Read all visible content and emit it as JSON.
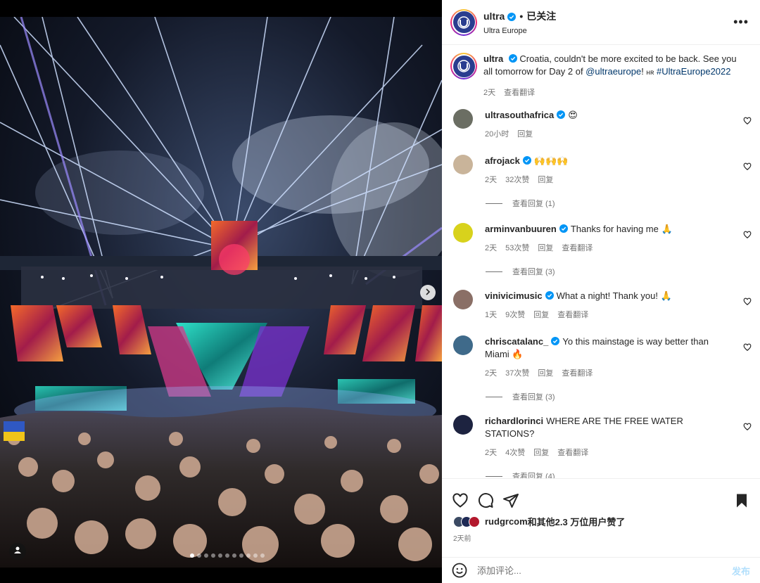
{
  "post": {
    "username": "ultra",
    "follow_status": "已关注",
    "location": "Ultra Europe",
    "more_icon": "more-horizontal-icon"
  },
  "caption": {
    "username": "ultra",
    "text": "Croatia, couldn't be more excited to be back. See you all tomorrow for Day 2 of ",
    "mention": "@ultraeurope",
    "text2": "! ",
    "photo_credit": "ʜʀ",
    "hashtag": "#UltraEurope2022",
    "time": "2天",
    "translate": "查看翻译"
  },
  "comments": [
    {
      "username": "ultrasouthafrica",
      "text": "😍",
      "time": "20小时",
      "likes": "",
      "reply": "回复",
      "translate": "",
      "replies": "",
      "avatar_color": "#6b6e63"
    },
    {
      "username": "afrojack",
      "text": "🙌🙌🙌",
      "time": "2天",
      "likes": "32次赞",
      "reply": "回复",
      "translate": "",
      "replies": "查看回复 (1)",
      "avatar_color": "#c9b49a"
    },
    {
      "username": "arminvanbuuren",
      "text": "Thanks for having me 🙏",
      "time": "2天",
      "likes": "53次赞",
      "reply": "回复",
      "translate": "查看翻译",
      "replies": "查看回复 (3)",
      "avatar_color": "#d8d21c"
    },
    {
      "username": "vinivicimusic",
      "text": "What a night! Thank you! 🙏",
      "time": "1天",
      "likes": "9次赞",
      "reply": "回复",
      "translate": "查看翻译",
      "replies": "",
      "avatar_color": "#8a6f66"
    },
    {
      "username": "chriscatalanc_",
      "text": "Yo this mainstage is way better than Miami 🔥",
      "time": "2天",
      "likes": "37次赞",
      "reply": "回复",
      "translate": "查看翻译",
      "replies": "查看回复 (3)",
      "avatar_color": "#3f6a8a"
    },
    {
      "username": "richardlorinci",
      "text": "WHERE ARE THE FREE WATER STATIONS?",
      "time": "2天",
      "likes": "4次赞",
      "reply": "回复",
      "translate": "查看翻译",
      "replies": "查看回复 (4)",
      "avatar_color": "#1d2340"
    }
  ],
  "actions": {
    "like_icon": "heart-icon",
    "comment_icon": "comment-icon",
    "share_icon": "share-icon",
    "save_icon": "bookmark-icon"
  },
  "likes": {
    "liker": "rudgrcom",
    "text": "和其他2.3 万位用户赞了"
  },
  "posted_time": "2天前",
  "add_comment": {
    "placeholder": "添加评论...",
    "post_label": "发布"
  },
  "media": {
    "slide_count": 11,
    "active_slide": 1
  },
  "colors": {
    "verified": "#0095f6",
    "link": "#00376b",
    "muted": "#737373",
    "post_button": "#b2dffc"
  }
}
